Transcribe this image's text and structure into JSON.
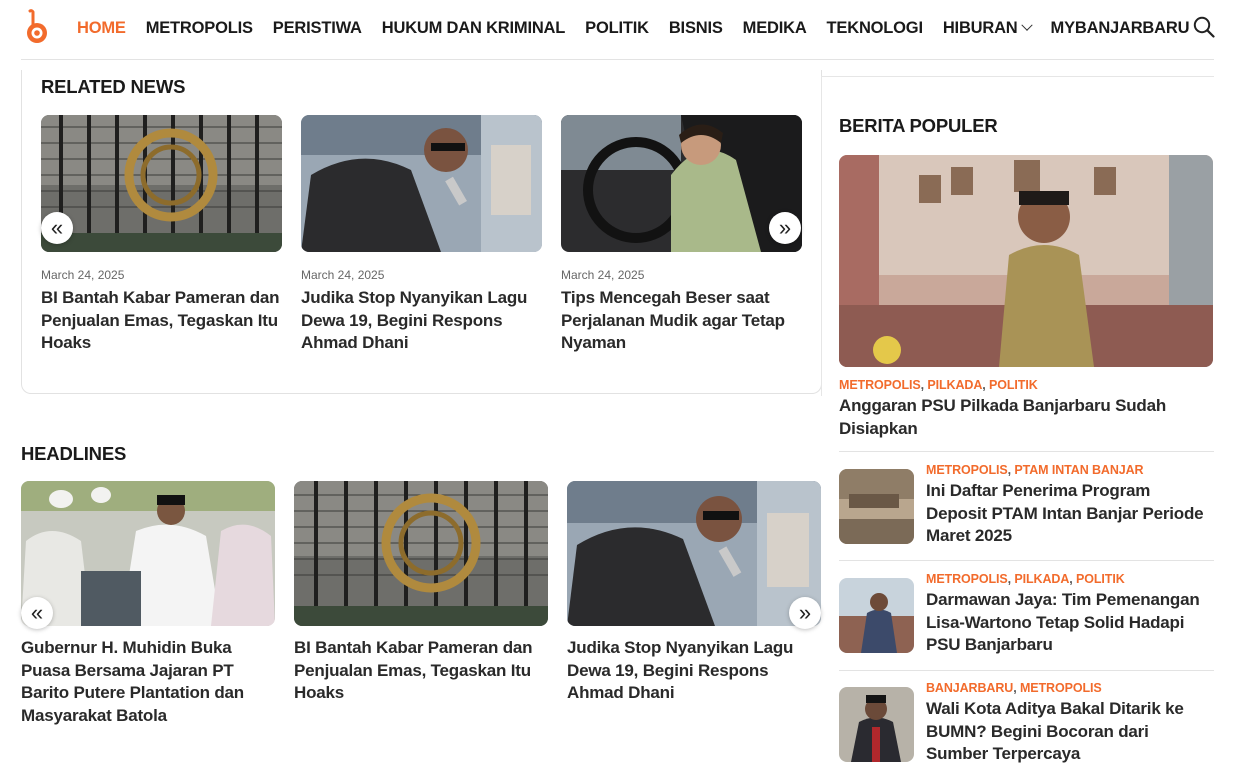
{
  "brand": {
    "accent": "#f26b2c",
    "logo": "b-logo"
  },
  "nav": {
    "items": [
      {
        "label": "HOME",
        "active": true
      },
      {
        "label": "METROPOLIS"
      },
      {
        "label": "PERISTIWA"
      },
      {
        "label": "HUKUM DAN KRIMINAL"
      },
      {
        "label": "POLITIK"
      },
      {
        "label": "BISNIS"
      },
      {
        "label": "MEDIKA"
      },
      {
        "label": "TEKNOLOGI"
      },
      {
        "label": "HIBURAN",
        "dropdown": true
      },
      {
        "label": "MYBANJARBARU"
      }
    ],
    "search_icon": "search-icon"
  },
  "related": {
    "title": "RELATED NEWS",
    "prev": "«",
    "next": "»",
    "cards": [
      {
        "date": "March 24, 2025",
        "title": "BI Bantah Kabar Pameran dan Penjualan Emas, Tegaskan Itu Hoaks"
      },
      {
        "date": "March 24, 2025",
        "title": "Judika Stop Nyanyikan Lagu Dewa 19, Begini Respons Ahmad Dhani"
      },
      {
        "date": "March 24, 2025",
        "title": "Tips Mencegah Beser saat Perjalanan Mudik agar Tetap Nyaman"
      }
    ]
  },
  "headlines": {
    "title": "HEADLINES",
    "prev": "«",
    "next": "»",
    "cards": [
      {
        "title": "Gubernur H. Muhidin Buka Puasa Bersama Jajaran PT Barito Putere Plantation dan Masyarakat Batola"
      },
      {
        "title": "BI Bantah Kabar Pameran dan Penjualan Emas, Tegaskan Itu Hoaks"
      },
      {
        "title": "Judika Stop Nyanyikan Lagu Dewa 19, Begini Respons Ahmad Dhani"
      }
    ]
  },
  "popular": {
    "title": "BERITA POPULER",
    "main": {
      "cats": [
        "METROPOLIS",
        "PILKADA",
        "POLITIK"
      ],
      "title": "Anggaran PSU Pilkada Banjarbaru Sudah Disiapkan"
    },
    "items": [
      {
        "cats": [
          "METROPOLIS",
          "PTAM INTAN BANJAR"
        ],
        "title": "Ini Daftar Penerima Program Deposit PTAM Intan Banjar Periode Maret 2025"
      },
      {
        "cats": [
          "METROPOLIS",
          "PILKADA",
          "POLITIK"
        ],
        "title": "Darmawan Jaya: Tim Pemenangan Lisa-Wartono Tetap Solid Hadapi PSU Banjarbaru"
      },
      {
        "cats": [
          "BANJARBARU",
          "METROPOLIS"
        ],
        "title": "Wali Kota Aditya Bakal Ditarik ke BUMN? Begini Bocoran dari Sumber Terpercaya"
      }
    ]
  }
}
